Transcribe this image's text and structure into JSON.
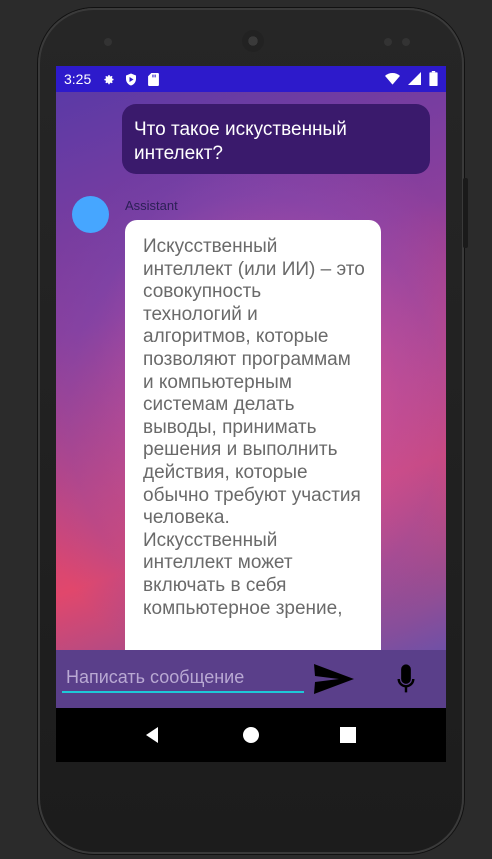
{
  "status_bar": {
    "time": "3:25",
    "left_icons": [
      "settings-icon",
      "shield-icon",
      "sd-card-icon"
    ],
    "right_icons": [
      "wifi-icon",
      "signal-icon",
      "battery-icon"
    ],
    "color": "#2d1acb"
  },
  "chat": {
    "user_message": "Что такое искуственный интелект?",
    "assistant": {
      "sender_name": "Assistant",
      "avatar_color": "#46a6ff",
      "message": "Искусственный интеллект (или ИИ) – это совокупность технологий и алгоритмов, которые позволяют программам и компьютерным системам делать выводы, принимать решения и выполнить действия, которые обычно требуют участия человека. Искусственный интеллект может включать в себя компьютерное зрение,"
    }
  },
  "composer": {
    "placeholder": "Написать сообщение",
    "value": "",
    "send_icon": "send-icon",
    "mic_icon": "mic-icon",
    "accent": "#1ec8d8"
  },
  "navigation": {
    "buttons": [
      "back-icon",
      "home-icon",
      "recents-icon"
    ]
  }
}
